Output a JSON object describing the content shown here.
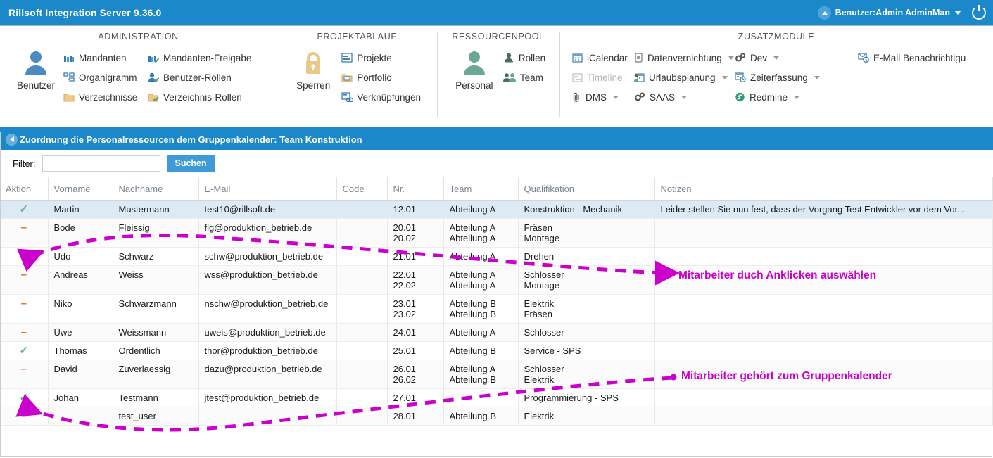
{
  "titlebar": {
    "app_title": "Rillsoft Integration Server 9.36.0",
    "user_label": "Benutzer:Admin AdminMan",
    "user_icon": "chevron-up-circle-icon",
    "dropdown_icon": "caret-down-icon",
    "power_icon": "power-icon",
    "accent_color": "#1b88c9"
  },
  "ribbon": {
    "groups": [
      {
        "title": "ADMINISTRATION",
        "big": {
          "label": "Benutzer",
          "icon": "user-icon"
        },
        "columns": [
          [
            {
              "label": "Mandanten",
              "icon": "factory-icon",
              "has_caret": false,
              "disabled": false
            },
            {
              "label": "Organigramm",
              "icon": "orgchart-icon",
              "has_caret": false,
              "disabled": false
            },
            {
              "label": "Verzeichnisse",
              "icon": "folder-icon",
              "has_caret": false,
              "disabled": false
            }
          ],
          [
            {
              "label": "Mandanten-Freigabe",
              "icon": "factory-check-icon",
              "has_caret": false,
              "disabled": false
            },
            {
              "label": "Benutzer-Rollen",
              "icon": "user-check-icon",
              "has_caret": false,
              "disabled": false
            },
            {
              "label": "Verzeichnis-Rollen",
              "icon": "folder-check-icon",
              "has_caret": false,
              "disabled": false
            }
          ]
        ]
      },
      {
        "title": "PROJEKTABLAUF",
        "big": {
          "label": "Sperren",
          "icon": "lock-icon"
        },
        "columns": [
          [
            {
              "label": "Projekte",
              "icon": "project-icon",
              "has_caret": false,
              "disabled": false
            },
            {
              "label": "Portfolio",
              "icon": "portfolio-icon",
              "has_caret": false,
              "disabled": false
            },
            {
              "label": "Verknüpfungen",
              "icon": "link-icon",
              "has_caret": false,
              "disabled": false
            }
          ]
        ]
      },
      {
        "title": "RESSOURCENPOOL",
        "big": {
          "label": "Personal",
          "icon": "person-green-icon"
        },
        "columns": [
          [
            {
              "label": "Rollen",
              "icon": "role-icon",
              "has_caret": false,
              "disabled": false
            },
            {
              "label": "Team",
              "icon": "team-icon",
              "has_caret": false,
              "disabled": false
            }
          ]
        ]
      },
      {
        "title": "ZUSATZMODULE",
        "big": null,
        "columns": [
          [
            {
              "label": "iCalendar",
              "icon": "calendar-icon",
              "has_caret": false,
              "disabled": false
            },
            {
              "label": "Timeline",
              "icon": "timeline-icon",
              "has_caret": false,
              "disabled": true
            },
            {
              "label": "DMS",
              "icon": "paperclip-icon",
              "has_caret": true,
              "disabled": false
            }
          ],
          [
            {
              "label": "Datenvernichtung",
              "icon": "shredder-icon",
              "has_caret": true,
              "disabled": false
            },
            {
              "label": "Urlaubsplanung",
              "icon": "vacation-icon",
              "has_caret": true,
              "disabled": false
            },
            {
              "label": "SAAS",
              "icon": "gears-icon",
              "has_caret": true,
              "disabled": false
            }
          ],
          [
            {
              "label": "Dev",
              "icon": "gears-icon",
              "has_caret": true,
              "disabled": false
            },
            {
              "label": "Zeiterfassung",
              "icon": "time-tracking-icon",
              "has_caret": true,
              "disabled": false
            },
            {
              "label": "Redmine",
              "icon": "redmine-icon",
              "has_caret": true,
              "disabled": false
            }
          ],
          [
            {
              "label": "E-Mail Benachrichtigu",
              "icon": "email-notify-icon",
              "has_caret": false,
              "disabled": false
            }
          ]
        ]
      }
    ]
  },
  "section": {
    "back_icon": "back-arrow-icon",
    "title": "Zuordnung die Personalressourcen dem Gruppenkalender: Team Konstruktion"
  },
  "filter": {
    "label": "Filter:",
    "value": "",
    "placeholder": "",
    "search_button": "Suchen"
  },
  "table": {
    "columns": [
      "Aktion",
      "Vorname",
      "Nachname",
      "E-Mail",
      "Code",
      "Nr.",
      "Team",
      "Qualifikation",
      "Notizen"
    ],
    "rows": [
      {
        "action": "check",
        "vorname": "Martin",
        "nachname": "Mustermann",
        "email": "test10@rillsoft.de",
        "code": "",
        "nr": [
          "12.01"
        ],
        "team": [
          "Abteilung A"
        ],
        "qualifikation": [
          "Konstruktion - Mechanik"
        ],
        "notizen": "Leider stellen Sie nun fest, dass der Vorgang Test Entwickler vor dem Vor...",
        "selected": true
      },
      {
        "action": "minus",
        "vorname": "Bode",
        "nachname": "Fleissig",
        "email": "flg@produktion_betrieb.de",
        "code": "",
        "nr": [
          "20.01",
          "20.02"
        ],
        "team": [
          "Abteilung A",
          "Abteilung A"
        ],
        "qualifikation": [
          "Fräsen",
          "Montage"
        ],
        "notizen": "",
        "selected": false
      },
      {
        "action": "minus",
        "vorname": "Udo",
        "nachname": "Schwarz",
        "email": "schw@produktion_betrieb.de",
        "code": "",
        "nr": [
          "21.01"
        ],
        "team": [
          "Abteilung A"
        ],
        "qualifikation": [
          "Drehen"
        ],
        "notizen": "",
        "selected": false
      },
      {
        "action": "minus",
        "vorname": "Andreas",
        "nachname": "Weiss",
        "email": "wss@produktion_betrieb.de",
        "code": "",
        "nr": [
          "22.01",
          "22.02"
        ],
        "team": [
          "Abteilung A",
          "Abteilung A"
        ],
        "qualifikation": [
          "Schlosser",
          "Montage"
        ],
        "notizen": "",
        "selected": false
      },
      {
        "action": "minus",
        "vorname": "Niko",
        "nachname": "Schwarzmann",
        "email": "nschw@produktion_betrieb.de",
        "code": "",
        "nr": [
          "23.01",
          "23.02"
        ],
        "team": [
          "Abteilung B",
          "Abteilung B"
        ],
        "qualifikation": [
          "Elektrik",
          "Fräsen"
        ],
        "notizen": "",
        "selected": false
      },
      {
        "action": "minus",
        "vorname": "Uwe",
        "nachname": "Weissmann",
        "email": "uweis@produktion_betrieb.de",
        "code": "",
        "nr": [
          "24.01"
        ],
        "team": [
          "Abteilung A"
        ],
        "qualifikation": [
          "Schlosser"
        ],
        "notizen": "",
        "selected": false
      },
      {
        "action": "check",
        "vorname": "Thomas",
        "nachname": "Ordentlich",
        "email": "thor@produktion_betrieb.de",
        "code": "",
        "nr": [
          "25.01"
        ],
        "team": [
          "Abteilung B"
        ],
        "qualifikation": [
          "Service - SPS"
        ],
        "notizen": "",
        "selected": false
      },
      {
        "action": "minus",
        "vorname": "David",
        "nachname": "Zuverlaessig",
        "email": "dazu@produktion_betrieb.de",
        "code": "",
        "nr": [
          "26.01",
          "26.02"
        ],
        "team": [
          "Abteilung A",
          "Abteilung B"
        ],
        "qualifikation": [
          "Schlosser",
          "Elektrik"
        ],
        "notizen": "",
        "selected": false
      },
      {
        "action": "check",
        "vorname": "Johan",
        "nachname": "Testmann",
        "email": "jtest@produktion_betrieb.de",
        "code": "",
        "nr": [
          "27.01"
        ],
        "team": [
          ""
        ],
        "qualifikation": [
          "Programmierung - SPS"
        ],
        "notizen": "",
        "selected": false
      },
      {
        "action": "minus",
        "vorname": "",
        "nachname": "test_user",
        "email": "",
        "code": "",
        "nr": [
          "28.01"
        ],
        "team": [
          "Abteilung B"
        ],
        "qualifikation": [
          "Elektrik"
        ],
        "notizen": "",
        "selected": false
      }
    ]
  },
  "annotations": {
    "color": "#cc00cc",
    "items": [
      {
        "text": "Mitarbeiter duch Anklicken auswählen"
      },
      {
        "text": "Mitarbeiter gehört zum Gruppenkalender"
      }
    ]
  }
}
